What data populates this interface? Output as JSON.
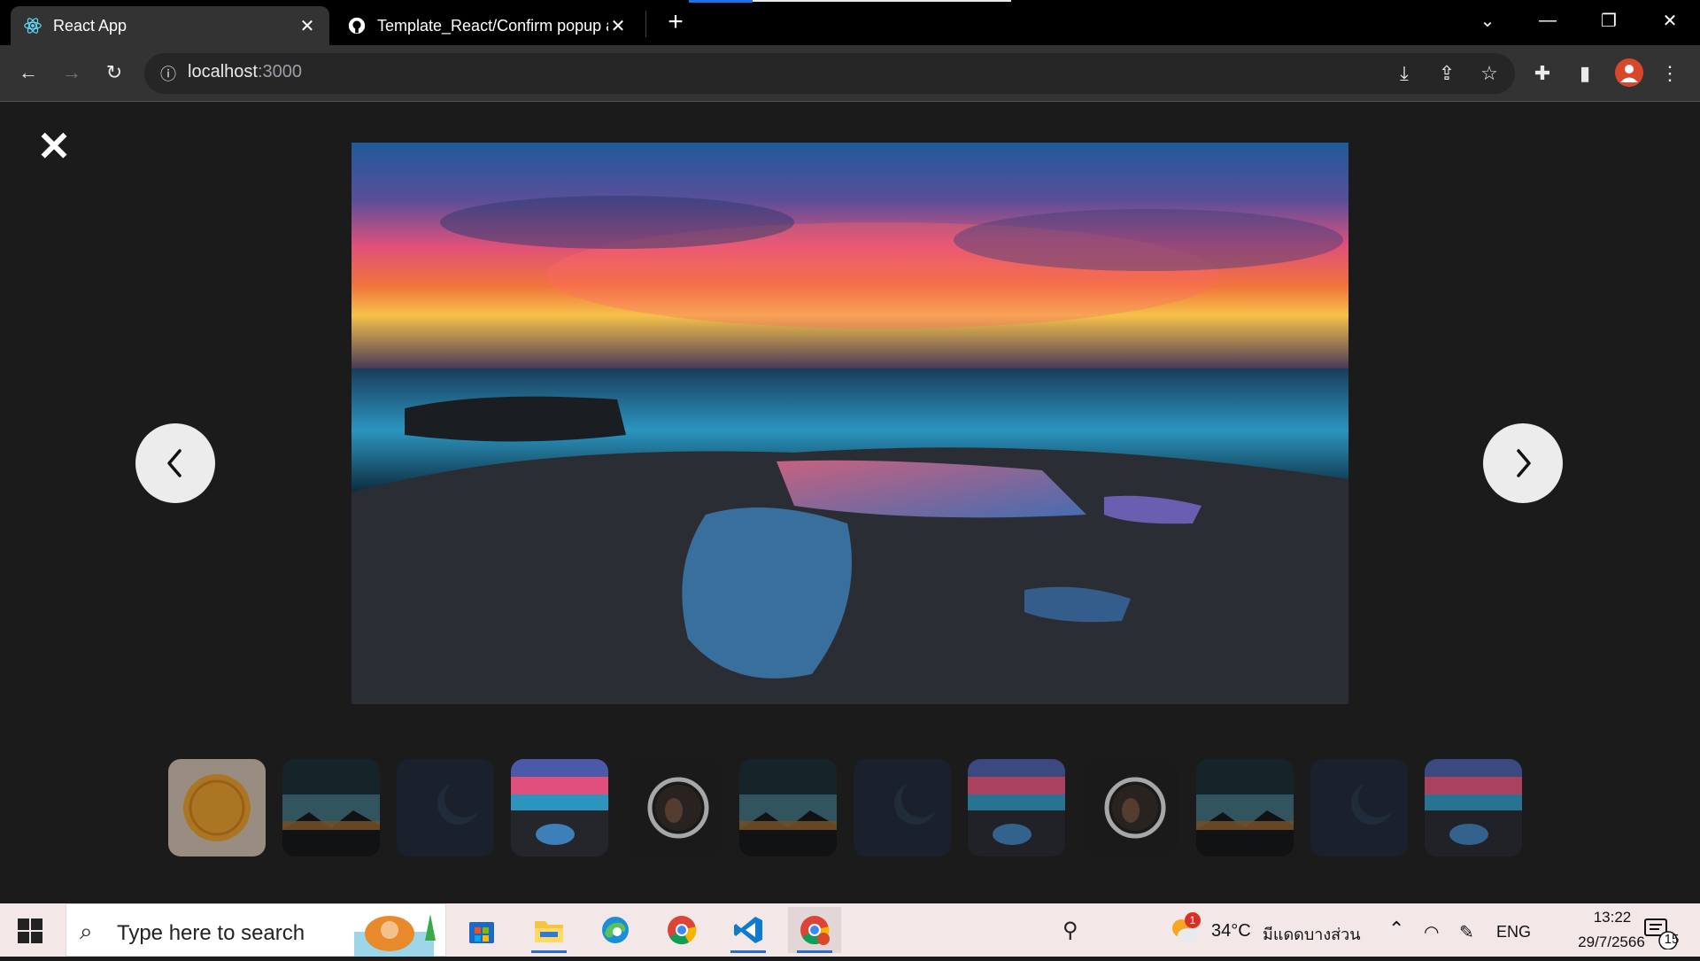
{
  "browser": {
    "tabs": [
      {
        "title": "React App",
        "active": true
      },
      {
        "title": "Template_React/Confirm popup at",
        "active": false
      }
    ],
    "new_tab_label": "+",
    "url_host": "localhost",
    "url_port": ":3000"
  },
  "viewer": {
    "close_label": "✕",
    "prev_label": "‹",
    "next_label": "›",
    "thumbnails": [
      "cookie",
      "landscape",
      "planet",
      "sunset",
      "astronaut",
      "landscape",
      "planet",
      "sunset",
      "astronaut",
      "landscape",
      "planet",
      "sunset"
    ],
    "selected_thumbnail_index": 3
  },
  "taskbar": {
    "search_placeholder": "Type here to search",
    "weather_temp": "34°C",
    "weather_desc": "มีแดดบางส่วน",
    "weather_badge": "1",
    "language": "ENG",
    "time": "13:22",
    "date": "29/7/2566",
    "notification_count": "15"
  },
  "colors": {
    "accent": "#1a73e8",
    "tab_active": "#333333",
    "page_bg": "#1b1b1b",
    "taskbar_bg": "#f3e7e7"
  }
}
